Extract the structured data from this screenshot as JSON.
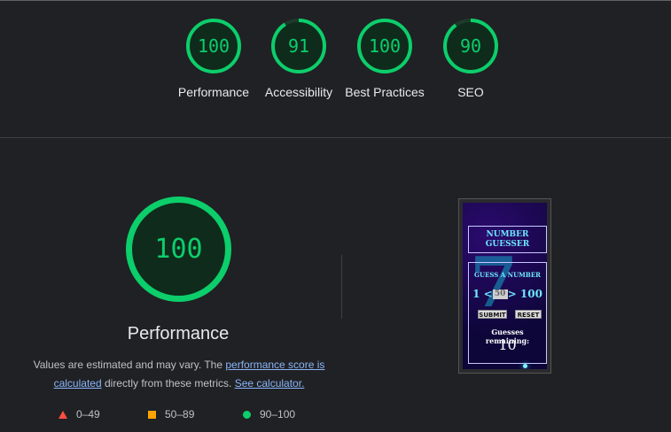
{
  "summary_gauges": [
    {
      "score": "100",
      "label": "Performance"
    },
    {
      "score": "91",
      "label": "Accessibility"
    },
    {
      "score": "100",
      "label": "Best Practices"
    },
    {
      "score": "90",
      "label": "SEO"
    }
  ],
  "main": {
    "score": "100",
    "title": "Performance",
    "note_prefix": "Values are estimated and may vary. The ",
    "score_link": "performance score is calculated",
    "note_middle": " directly from these metrics. ",
    "calculator_link": "See calculator."
  },
  "legend": [
    {
      "range": "0–49",
      "color": "#ff4e42",
      "shape": "triangle"
    },
    {
      "range": "50–89",
      "color": "#ffa400",
      "shape": "square"
    },
    {
      "range": "90–100",
      "color": "#0cce6b",
      "shape": "circle"
    }
  ],
  "screenshot": {
    "title": "NUMBER GUESSER",
    "heading": "GUESS A NUMBER",
    "range_low": "1 <",
    "input_placeholder": "50",
    "range_high": "> 100",
    "submit_label": "SUBMIT",
    "reset_label": "RESET",
    "remaining_label": "Guesses remaining:",
    "remaining_count": "10"
  },
  "colors": {
    "pass": "#0cce6b",
    "background": "#202124",
    "link": "#8ab4f8"
  }
}
